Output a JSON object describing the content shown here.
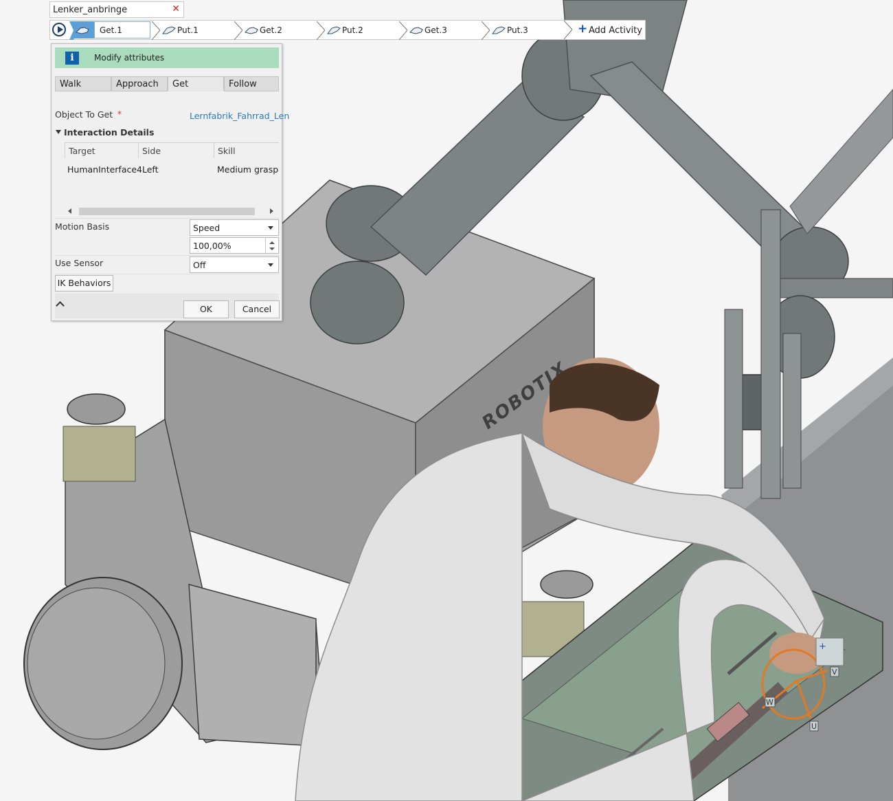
{
  "document": {
    "title": "Lenker_anbringe"
  },
  "sequence": {
    "steps": [
      {
        "label": "Get.1",
        "type": "get",
        "active": true
      },
      {
        "label": "Put.1",
        "type": "put"
      },
      {
        "label": "Get.2",
        "type": "get"
      },
      {
        "label": "Put.2",
        "type": "put"
      },
      {
        "label": "Get.3",
        "type": "get"
      },
      {
        "label": "Put.3",
        "type": "put"
      }
    ],
    "add_label": "Add Activity"
  },
  "panel": {
    "header": "Modify attributes",
    "info_glyph": "i",
    "tabs": [
      "Walk",
      "Approach",
      "Get",
      "Follow"
    ],
    "selected_tab": "Get",
    "object_to_get": {
      "label": "Object To Get",
      "required": "*",
      "value": "Lernfabrik_Fahrrad_Len"
    },
    "interaction": {
      "title": "Interaction Details",
      "columns": [
        "Target",
        "Side",
        "Skill"
      ],
      "rows": [
        {
          "target": "HumanInterface4",
          "side": "Left",
          "skill": "Medium grasp"
        }
      ]
    },
    "motion_basis": {
      "label": "Motion Basis",
      "mode": "Speed",
      "value": "100,00%"
    },
    "use_sensor": {
      "label": "Use Sensor",
      "value": "Off"
    },
    "ik_button": "IK Behaviors",
    "ok": "OK",
    "cancel": "Cancel"
  },
  "viewport": {
    "robot_brand": "ROBOTIX",
    "axis_labels": [
      "V",
      "W",
      "U"
    ],
    "colors": {
      "body": "#9b9b9b",
      "arm": "#808585",
      "manipulator": "#e07a25",
      "tray": "#7d8a80"
    }
  }
}
